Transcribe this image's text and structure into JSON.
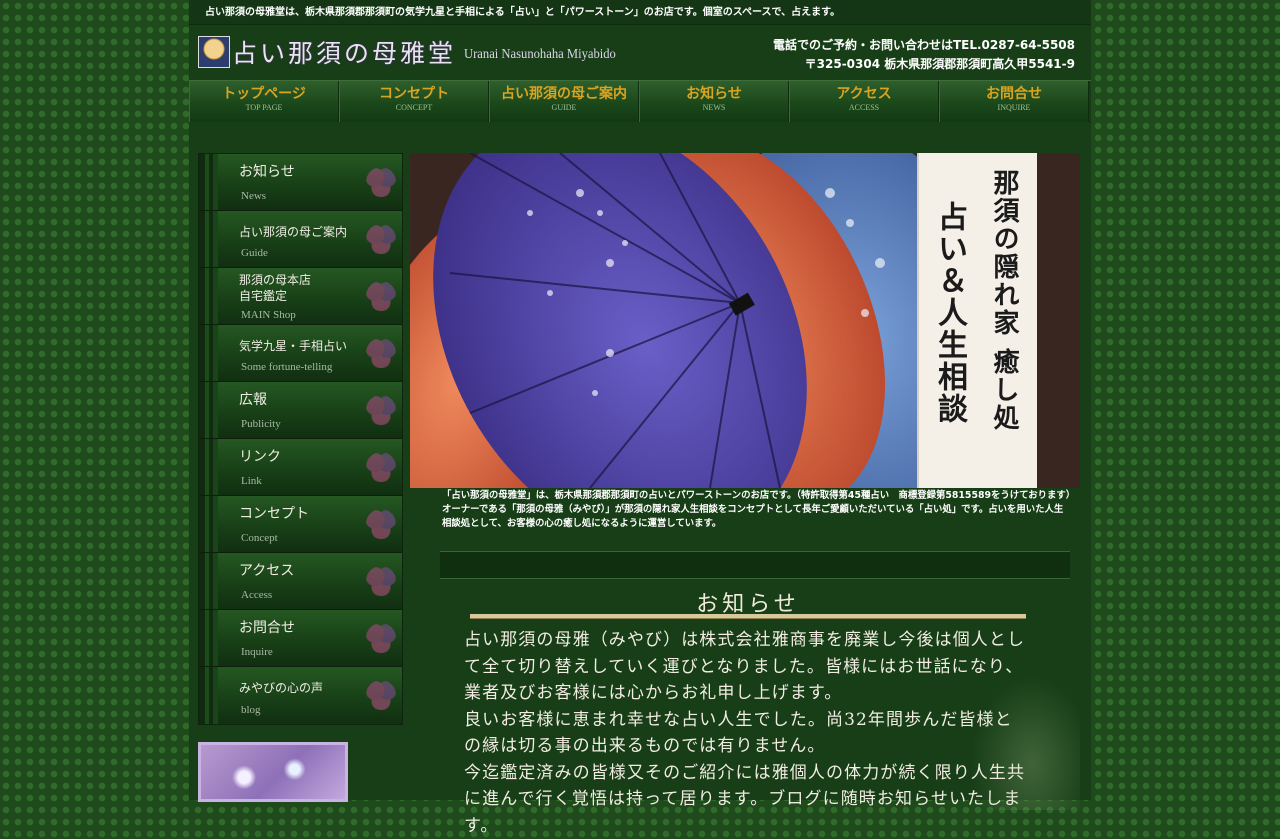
{
  "topbar": {
    "text": "占い那須の母雅堂は、栃木県那須郡那須町の気学九星と手相による「占い」と「パワーストーン」のお店です。個室のスペースで、占えます。"
  },
  "header": {
    "logo_title": "占い那須の母雅堂",
    "logo_subtitle": "Uranai Nasunohaha Miyabido",
    "contact_phone": "電話でのご予約・お問い合わせはTEL.0287-64-5508",
    "contact_address": "〒325-0304 栃木県那須郡那須町高久甲5541-9"
  },
  "nav": [
    {
      "jp": "トップページ",
      "en": "TOP PAGE"
    },
    {
      "jp": "コンセプト",
      "en": "CONCEPT"
    },
    {
      "jp": "占い那須の母ご案内",
      "en": "GUIDE"
    },
    {
      "jp": "お知らせ",
      "en": "NEWS"
    },
    {
      "jp": "アクセス",
      "en": "ACCESS"
    },
    {
      "jp": "お問合せ",
      "en": "INQUIRE"
    }
  ],
  "sidebar": [
    {
      "jp": "お知らせ",
      "en": "News"
    },
    {
      "jp": "占い那須の母ご案内",
      "en": "Guide"
    },
    {
      "jp": "那須の母本店\n自宅鑑定",
      "en": "MAIN Shop"
    },
    {
      "jp": "気学九星・手相占い",
      "en": "Some fortune-telling"
    },
    {
      "jp": "広報",
      "en": "Publicity"
    },
    {
      "jp": "リンク",
      "en": "Link"
    },
    {
      "jp": "コンセプト",
      "en": "Concept"
    },
    {
      "jp": "アクセス",
      "en": "Access"
    },
    {
      "jp": "お問合せ",
      "en": "Inquire"
    },
    {
      "jp": "みやびの心の声",
      "en": "blog"
    }
  ],
  "hero": {
    "sign_col1": "那須の隠れ家 癒し処",
    "sign_col2": "占い＆人生相談"
  },
  "intro": "「占い那須の母雅堂」は、栃木県那須郡那須町の占いとパワーストーンのお店です。（特許取得第45種占い　商標登録第5815589をうけております）オーナーである「那須の母雅（みやび）」が那須の隠れ家人生相談をコンセプトとして長年ご愛顧いただいている「占い処」です。占いを用いた人生相談処として、お客様の心の癒し処になるように運営しています。",
  "news": {
    "title": "お知らせ",
    "body": "占い那須の母雅（みやび）は株式会社雅商事を廃業し今後は個人として全て切り替えしていく運びとなりました。皆様にはお世話になり、業者及びお客様には心からお礼申し上げます。\n良いお客様に恵まれ幸せな占い人生でした。尚32年間歩んだ皆様との縁は切る事の出来るものでは有りません。\n今迄鑑定済みの皆様又そのご紹介には雅個人の体力が続く限り人生共に進んで行く覚悟は持って居ります。ブログに随時お知らせいたします。"
  },
  "colors": {
    "background": "#1e4a1c",
    "page": "#173e17",
    "nav_text": "#d9a421",
    "news_rule": "#d6c99a"
  }
}
